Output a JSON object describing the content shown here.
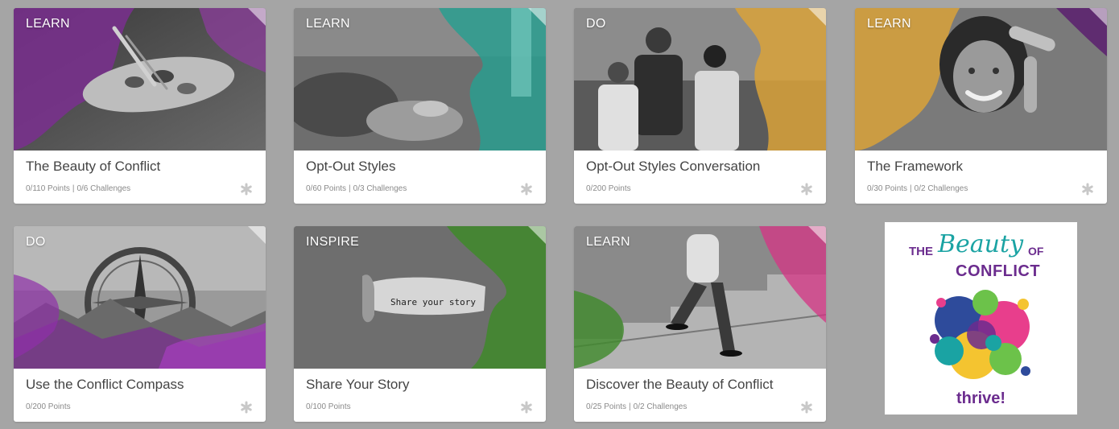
{
  "cards": [
    {
      "category": "LEARN",
      "title": "The Beauty of Conflict",
      "points": "0/110 Points",
      "challenges": "0/6 Challenges",
      "image_icon": "artist-palette-image",
      "accent": "#7a2f8f"
    },
    {
      "category": "LEARN",
      "title": "Opt-Out Styles",
      "points": "0/60 Points",
      "challenges": "0/3 Challenges",
      "image_icon": "group-discussion-image",
      "accent": "#2a9d8f"
    },
    {
      "category": "DO",
      "title": "Opt-Out Styles Conversation",
      "points": "0/200 Points",
      "challenges": "",
      "image_icon": "coworkers-conversation-image",
      "accent": "#d9a23a"
    },
    {
      "category": "LEARN",
      "title": "The Framework",
      "points": "0/30 Points",
      "challenges": "0/2 Challenges",
      "image_icon": "smiling-woman-frame-image",
      "accent": "#d9a23a"
    },
    {
      "category": "DO",
      "title": "Use the Conflict Compass",
      "points": "0/200 Points",
      "challenges": "",
      "image_icon": "compass-mountains-image",
      "accent": "#8e2fa8"
    },
    {
      "category": "INSPIRE",
      "title": "Share Your Story",
      "points": "0/100 Points",
      "challenges": "",
      "image_icon": "torn-paper-image",
      "image_text": "Share your story",
      "accent": "#3f8a2a"
    },
    {
      "category": "LEARN",
      "title": "Discover the Beauty of Conflict",
      "points": "0/25 Points",
      "challenges": "0/2 Challenges",
      "image_icon": "walking-stairs-image",
      "accent": "#d63384"
    }
  ],
  "separator": "|",
  "logo": {
    "the": "THE",
    "beauty": "Beauty",
    "of": "OF",
    "conflict": "CONFLICT",
    "brand": "thrive!",
    "colors": [
      "#6b2c8e",
      "#1aa3a3",
      "#f4c430",
      "#e83e8c",
      "#2e4b9b",
      "#6cc24a"
    ]
  }
}
